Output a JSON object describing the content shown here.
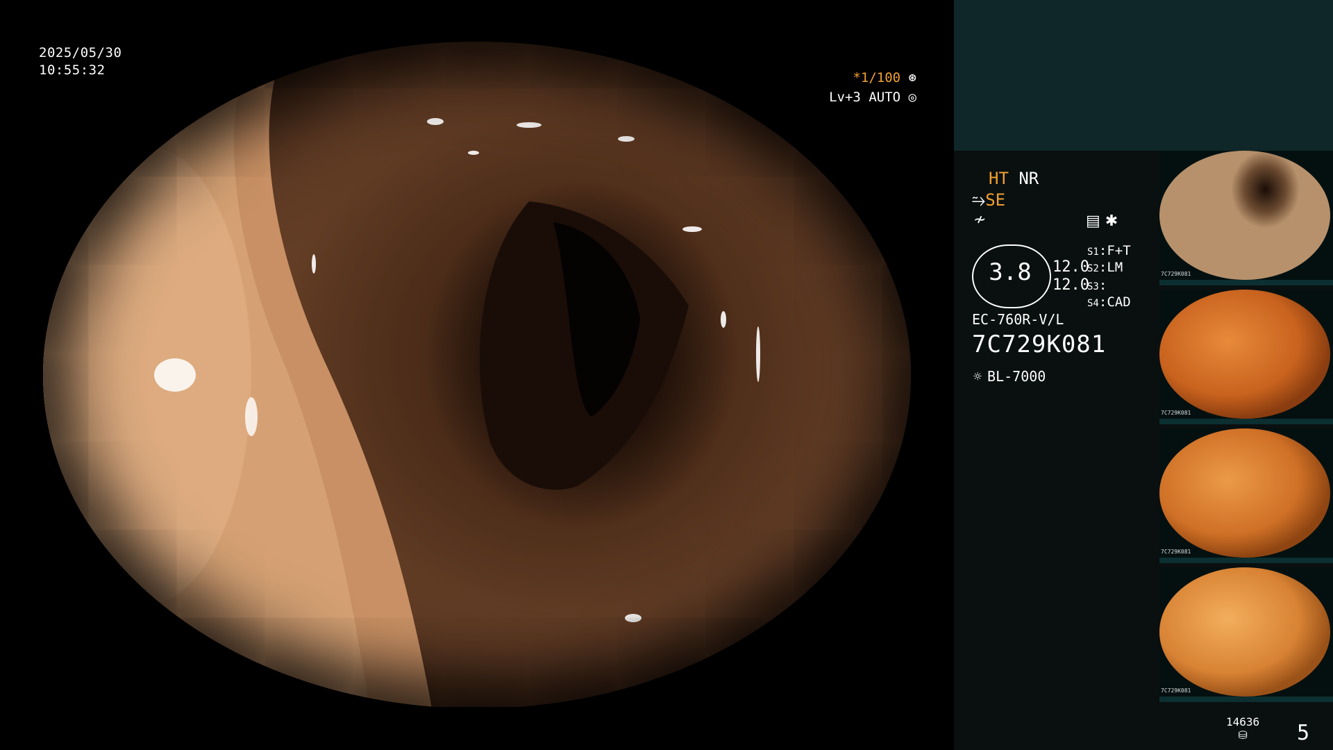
{
  "overlay": {
    "date": "2025/05/30",
    "time": "10:55:32",
    "shutter": "*1/100",
    "level": "Lv+3",
    "exposure_mode": "AUTO"
  },
  "panel": {
    "ht": "HT",
    "nr": "NR",
    "se": "SE",
    "gauge_value": "3.8",
    "value_top": "12.0",
    "value_bottom": "12.0",
    "s_rows": [
      {
        "key": "S1",
        "value": "F+T"
      },
      {
        "key": "S2",
        "value": "LM"
      },
      {
        "key": "S3",
        "value": ""
      },
      {
        "key": "S4",
        "value": "CAD"
      }
    ],
    "scope_model": "EC-760R-V/L",
    "scope_serial": "7C729K081",
    "light_source": "BL-7000",
    "storage_count": "14636",
    "image_count": "5",
    "thumb_label": "7C729K081"
  },
  "colors": {
    "accent_orange": "#f0a030",
    "panel_top": "#0f2729",
    "panel_bg": "#0a0f10"
  }
}
